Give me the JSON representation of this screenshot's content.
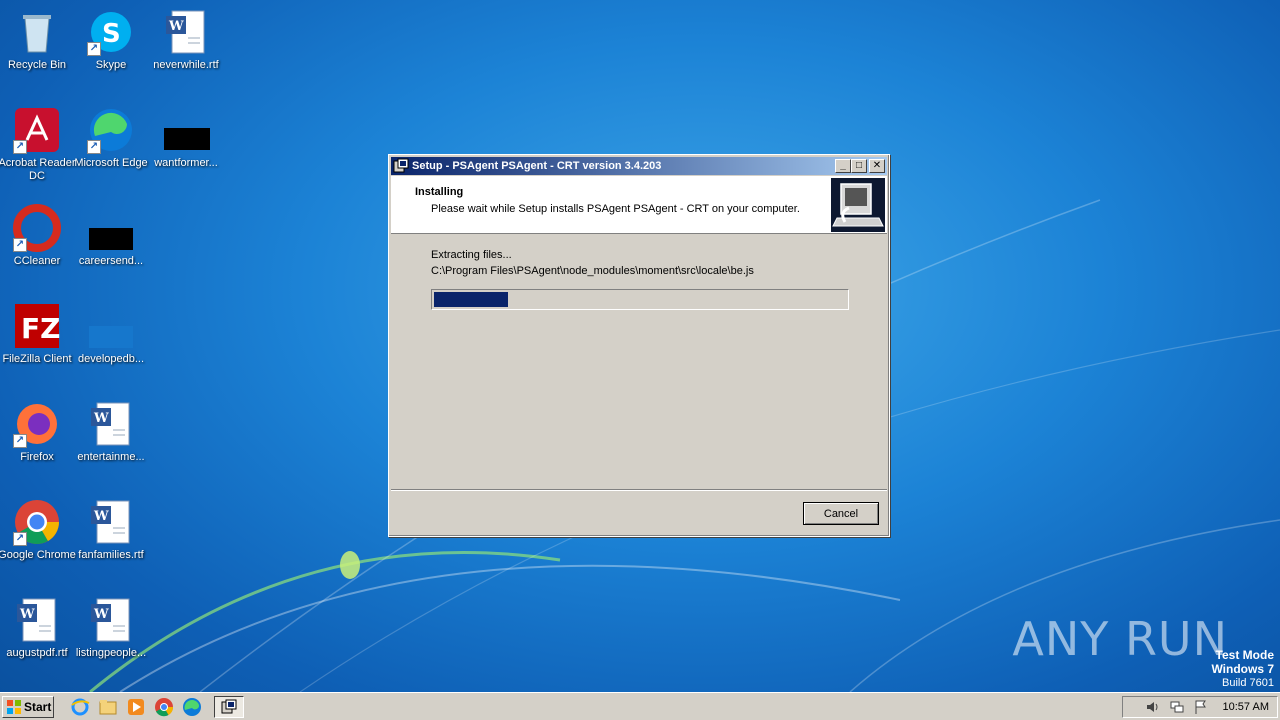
{
  "desktop": {
    "icons": [
      {
        "label": "Recycle Bin"
      },
      {
        "label": "Skype"
      },
      {
        "label": "neverwhile.rtf"
      },
      {
        "label": "Acrobat Reader DC"
      },
      {
        "label": "Microsoft Edge"
      },
      {
        "label": "wantformer..."
      },
      {
        "label": "CCleaner"
      },
      {
        "label": "careersend..."
      },
      {
        "label": "FileZilla Client"
      },
      {
        "label": "developedb..."
      },
      {
        "label": "Firefox"
      },
      {
        "label": "entertainme..."
      },
      {
        "label": "Google Chrome"
      },
      {
        "label": "fanfamilies.rtf"
      },
      {
        "label": "augustpdf.rtf"
      },
      {
        "label": "listingpeople..."
      }
    ]
  },
  "setup_window": {
    "title": "Setup - PSAgent PSAgent - CRT version 3.4.203",
    "header_title": "Installing",
    "header_subtitle": "Please wait while Setup installs PSAgent PSAgent - CRT on your computer.",
    "status_text": "Extracting files...",
    "current_file": "C:\\Program Files\\PSAgent\\node_modules\\moment\\src\\locale\\be.js",
    "progress_fraction": 0.18,
    "cancel_label": "Cancel",
    "minimize_glyph": "_",
    "maximize_glyph": "□",
    "close_glyph": "✕"
  },
  "watermark": {
    "text": "ANY RUN",
    "test_mode": "Test Mode",
    "os": "Windows 7",
    "build": "Build 7601"
  },
  "taskbar": {
    "start_label": "Start",
    "clock": "10:57 AM"
  },
  "colors": {
    "titlebar_start": "#0a246a",
    "titlebar_end": "#a6caf0",
    "progress_fill": "#0a246a",
    "window_face": "#d4d0c8"
  }
}
